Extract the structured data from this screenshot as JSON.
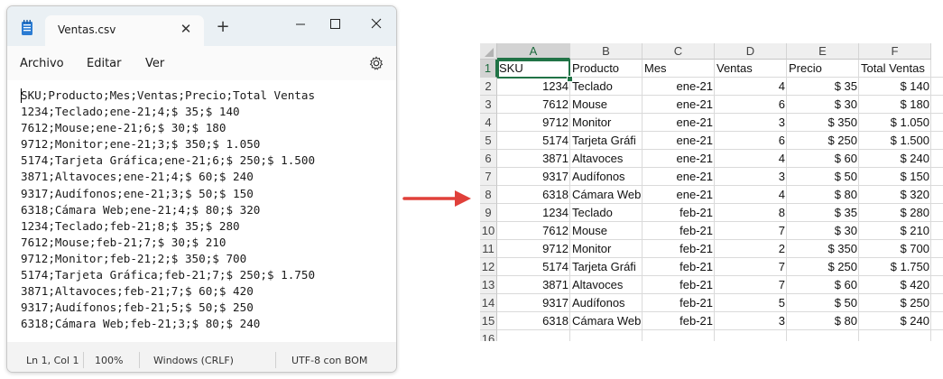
{
  "notepad": {
    "tab_title": "Ventas.csv",
    "tab_close": "✕",
    "new_tab": "+",
    "menu": [
      "Archivo",
      "Editar",
      "Ver"
    ],
    "lines": [
      "SKU;Producto;Mes;Ventas;Precio;Total Ventas",
      "1234;Teclado;ene-21;4;$ 35;$ 140",
      "7612;Mouse;ene-21;6;$ 30;$ 180",
      "9712;Monitor;ene-21;3;$ 350;$ 1.050",
      "5174;Tarjeta Gráfica;ene-21;6;$ 250;$ 1.500",
      "3871;Altavoces;ene-21;4;$ 60;$ 240",
      "9317;Audífonos;ene-21;3;$ 50;$ 150",
      "6318;Cámara Web;ene-21;4;$ 80;$ 320",
      "1234;Teclado;feb-21;8;$ 35;$ 280",
      "7612;Mouse;feb-21;7;$ 30;$ 210",
      "9712;Monitor;feb-21;2;$ 350;$ 700",
      "5174;Tarjeta Gráfica;feb-21;7;$ 250;$ 1.750",
      "3871;Altavoces;feb-21;7;$ 60;$ 420",
      "9317;Audífonos;feb-21;5;$ 50;$ 250",
      "6318;Cámara Web;feb-21;3;$ 80;$ 240"
    ],
    "status": {
      "position": "Ln 1, Col 1",
      "zoom": "100%",
      "line_ending": "Windows (CRLF)",
      "encoding": "UTF-8 con BOM"
    }
  },
  "excel": {
    "columns": [
      "A",
      "B",
      "C",
      "D",
      "E",
      "F"
    ],
    "row_numbers": [
      "1",
      "2",
      "3",
      "4",
      "5",
      "6",
      "7",
      "8",
      "9",
      "10",
      "11",
      "12",
      "13",
      "14",
      "15",
      "16"
    ],
    "header": [
      "SKU",
      "Producto",
      "Mes",
      "Ventas",
      "Precio",
      "Total Ventas"
    ],
    "rows": [
      [
        "1234",
        "Teclado",
        "ene-21",
        "4",
        "$ 35",
        "$ 140"
      ],
      [
        "7612",
        "Mouse",
        "ene-21",
        "6",
        "$ 30",
        "$ 180"
      ],
      [
        "9712",
        "Monitor",
        "ene-21",
        "3",
        "$ 350",
        "$ 1.050"
      ],
      [
        "5174",
        "Tarjeta Gráfi",
        "ene-21",
        "6",
        "$ 250",
        "$ 1.500"
      ],
      [
        "3871",
        "Altavoces",
        "ene-21",
        "4",
        "$ 60",
        "$ 240"
      ],
      [
        "9317",
        "Audífonos",
        "ene-21",
        "3",
        "$ 50",
        "$ 150"
      ],
      [
        "6318",
        "Cámara Web",
        "ene-21",
        "4",
        "$ 80",
        "$ 320"
      ],
      [
        "1234",
        "Teclado",
        "feb-21",
        "8",
        "$ 35",
        "$ 280"
      ],
      [
        "7612",
        "Mouse",
        "feb-21",
        "7",
        "$ 30",
        "$ 210"
      ],
      [
        "9712",
        "Monitor",
        "feb-21",
        "2",
        "$ 350",
        "$ 700"
      ],
      [
        "5174",
        "Tarjeta Gráfi",
        "feb-21",
        "7",
        "$ 250",
        "$ 1.750"
      ],
      [
        "3871",
        "Altavoces",
        "feb-21",
        "7",
        "$ 60",
        "$ 420"
      ],
      [
        "9317",
        "Audífonos",
        "feb-21",
        "5",
        "$ 50",
        "$ 250"
      ],
      [
        "6318",
        "Cámara Web",
        "feb-21",
        "3",
        "$ 80",
        "$ 240"
      ]
    ],
    "accent_color": "#217346"
  },
  "arrow_color": "#e0403a"
}
